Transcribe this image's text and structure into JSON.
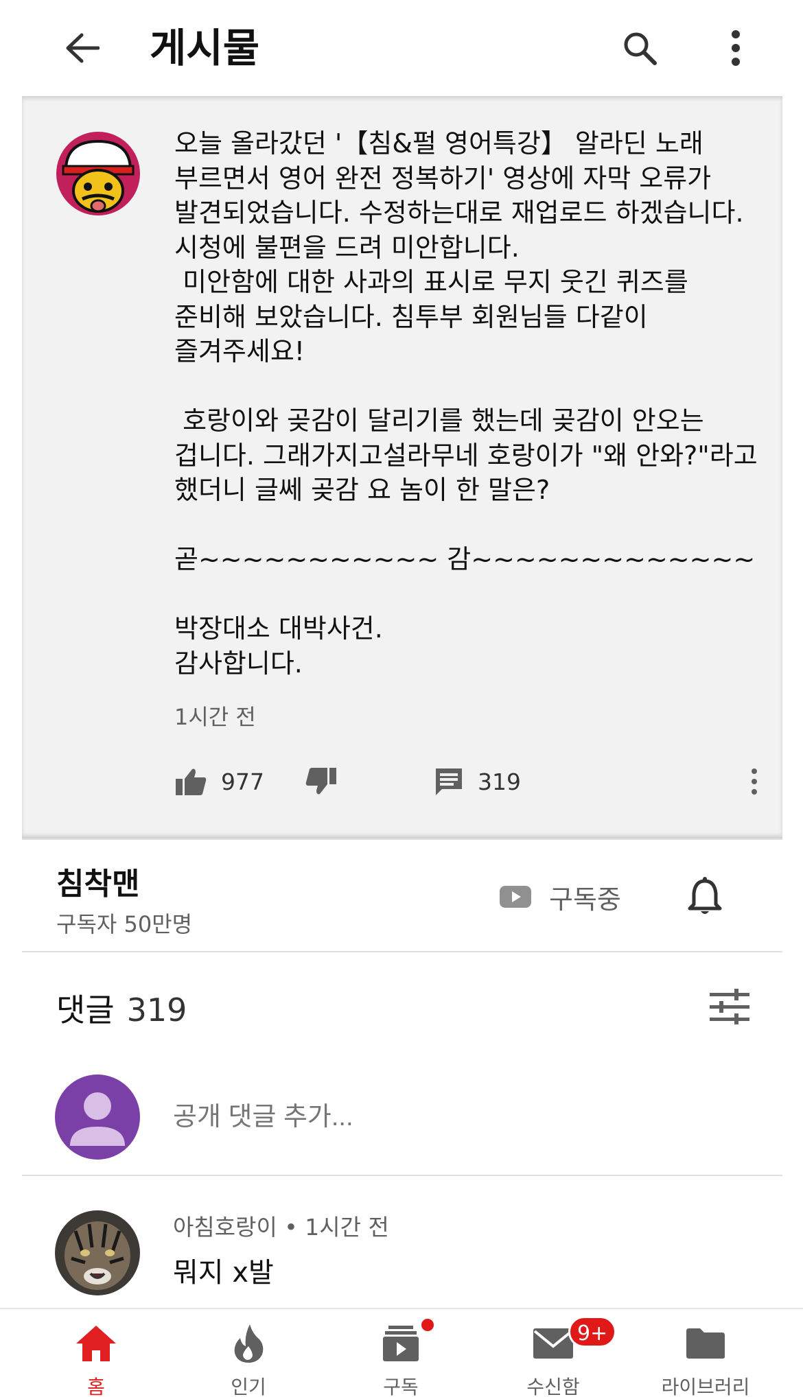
{
  "appbar": {
    "title": "게시물",
    "back_icon": "back-arrow-icon",
    "search_icon": "search-icon",
    "more_icon": "more-vertical-icon"
  },
  "post": {
    "avatar": "channel-avatar",
    "body": "오늘 올라갔던 '【침&펄 영어특강】 알라딘 노래 부르면서 영어 완전 정복하기' 영상에 자막 오류가 발견되었습니다. 수정하는대로 재업로드 하겠습니다. 시청에 불편을 드려 미안합니다.\n 미안함에 대한 사과의 표시로 무지 웃긴 퀴즈를 준비해 보았습니다. 침투부 회원님들 다같이 즐겨주세요!\n\n 호랑이와 곶감이 달리기를 했는데 곶감이 안오는 겁니다. 그래가지고설라무네 호랑이가 \"왜 안와?\"라고 했더니 글쎄 곶감 요 놈이 한 말은?\n\n곧~~~~~~~~~~~ 감~~~~~~~~~~~~~\n\n박장대소 대박사건.\n감사합니다.",
    "time": "1시간 전",
    "likes": "977",
    "comments": "319"
  },
  "channel": {
    "name": "침착맨",
    "subscribers": "구독자 50만명",
    "subscribed_label": "구독중"
  },
  "comments": {
    "header": "댓글",
    "count": "319",
    "add_placeholder": "공개 댓글 추가...",
    "items": [
      {
        "author": "아침호랑이",
        "time": "1시간 전",
        "text": "뭐지 x발"
      }
    ]
  },
  "bottom_nav": [
    {
      "label": "홈",
      "icon": "home-icon",
      "active": true
    },
    {
      "label": "인기",
      "icon": "fire-icon"
    },
    {
      "label": "구독",
      "icon": "subscriptions-icon"
    },
    {
      "label": "수신함",
      "icon": "inbox-icon",
      "badge": "9+"
    },
    {
      "label": "라이브러리",
      "icon": "library-icon"
    }
  ],
  "colors": {
    "accent": "#e02020",
    "post_bg": "#f2f2f2",
    "secondary_text": "#606060"
  }
}
